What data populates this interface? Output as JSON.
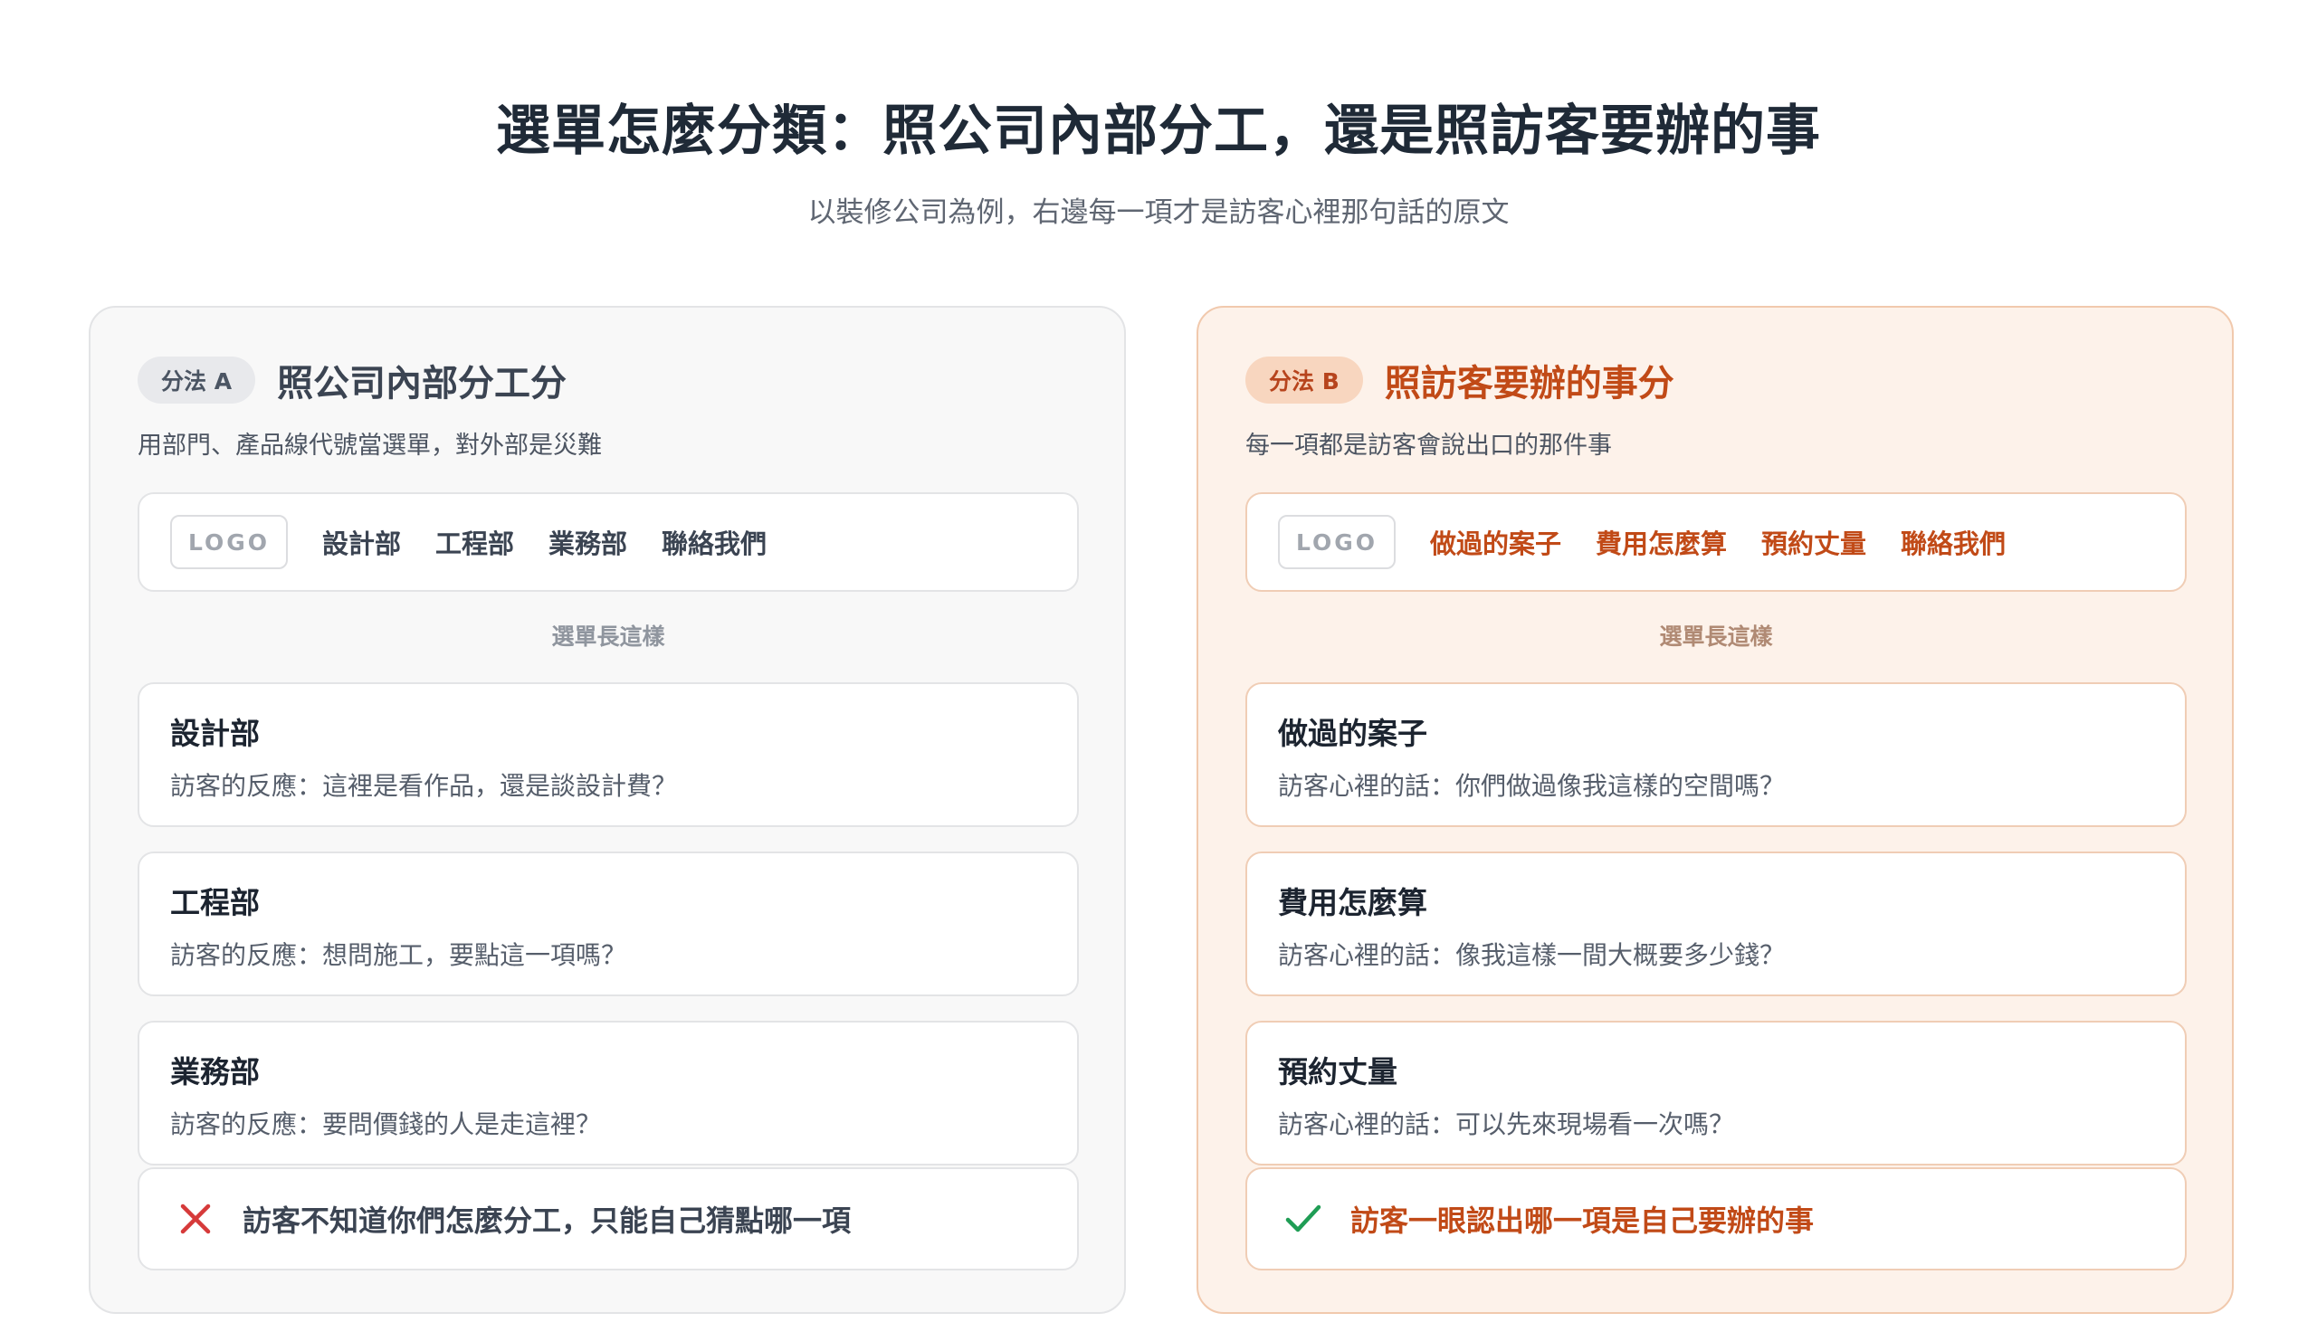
{
  "header": {
    "title": "選單怎麼分類：照公司內部分工，還是照訪客要辦的事",
    "subtitle": "以裝修公司為例，右邊每一項才是訪客心裡那句話的原文"
  },
  "panel_a": {
    "pill": "分法 A",
    "title": "照公司內部分工分",
    "description": "用部門、產品線代號當選單，對外部是災難",
    "logo": "LOGO",
    "nav": [
      "設計部",
      "工程部",
      "業務部",
      "聯絡我們"
    ],
    "caption": "選單長這樣",
    "cards": [
      {
        "title": "設計部",
        "note": "訪客的反應：這裡是看作品，還是談設計費？"
      },
      {
        "title": "工程部",
        "note": "訪客的反應：想問施工，要點這一項嗎？"
      },
      {
        "title": "業務部",
        "note": "訪客的反應：要問價錢的人是走這裡？"
      }
    ],
    "verdict": "訪客不知道你們怎麼分工，只能自己猜點哪一項",
    "verdict_icon": "cross-icon",
    "verdict_color": "#d63a3a"
  },
  "panel_b": {
    "pill": "分法 B",
    "title": "照訪客要辦的事分",
    "description": "每一項都是訪客會說出口的那件事",
    "logo": "LOGO",
    "nav": [
      "做過的案子",
      "費用怎麼算",
      "預約丈量",
      "聯絡我們"
    ],
    "caption": "選單長這樣",
    "cards": [
      {
        "title": "做過的案子",
        "note": "訪客心裡的話：你們做過像我這樣的空間嗎？"
      },
      {
        "title": "費用怎麼算",
        "note": "訪客心裡的話：像我這樣一間大概要多少錢？"
      },
      {
        "title": "預約丈量",
        "note": "訪客心裡的話：可以先來現場看一次嗎？"
      }
    ],
    "verdict": "訪客一眼認出哪一項是自己要辦的事",
    "verdict_icon": "check-icon",
    "verdict_color": "#1f9d55"
  }
}
